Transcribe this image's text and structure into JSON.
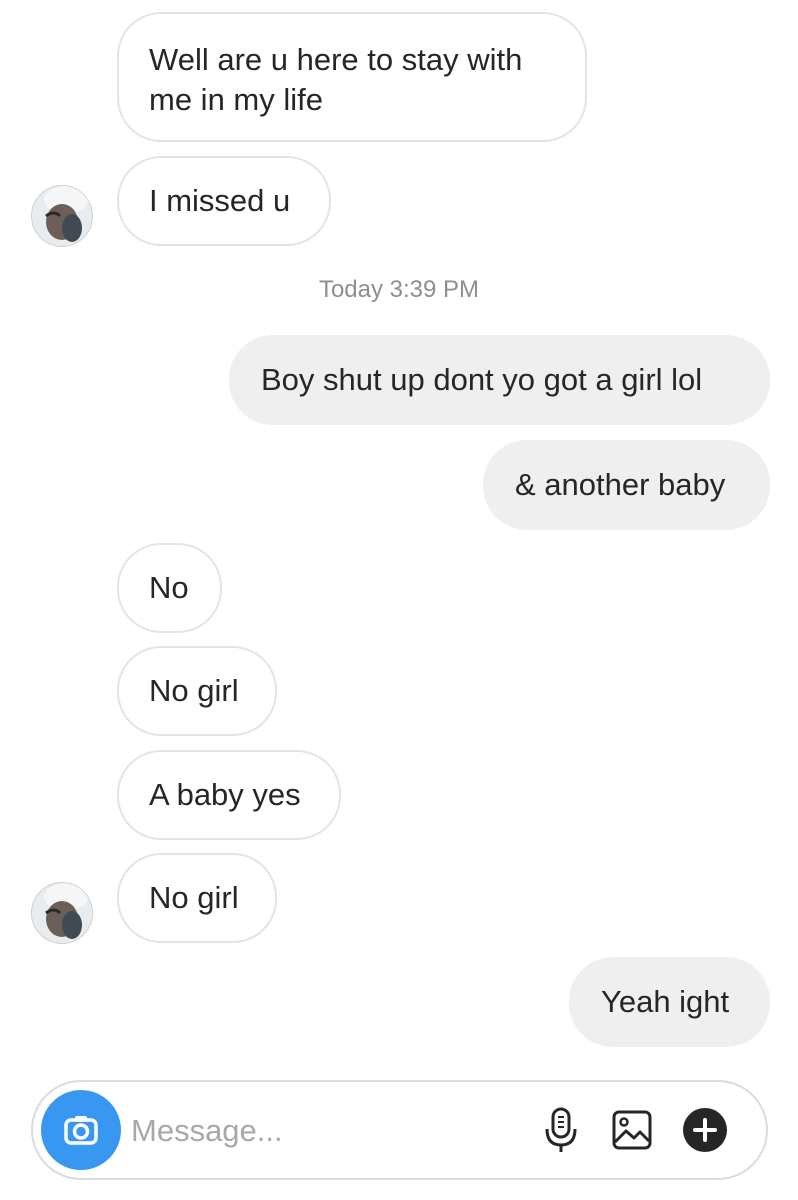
{
  "thread": {
    "messages": [
      {
        "sender": "them",
        "text": "Well are u here to stay with\nme in my life"
      },
      {
        "sender": "them",
        "text": "I missed u"
      },
      {
        "sender": "me",
        "text": "Boy shut up dont yo got a girl lol"
      },
      {
        "sender": "me",
        "text": "& another baby"
      },
      {
        "sender": "them",
        "text": "No"
      },
      {
        "sender": "them",
        "text": "No girl"
      },
      {
        "sender": "them",
        "text": "A baby yes"
      },
      {
        "sender": "them",
        "text": "No girl"
      },
      {
        "sender": "me",
        "text": "Yeah ight"
      }
    ],
    "timestamp": "Today 3:39 PM"
  },
  "composer": {
    "placeholder": "Message...",
    "icons": [
      "camera-icon",
      "microphone-icon",
      "gallery-icon",
      "plus-icon"
    ],
    "accent": "#3897f0"
  },
  "colors": {
    "incoming_bubble_border": "#e4e4e4",
    "outgoing_bubble_bg": "#efefef",
    "timestamp_text": "#8e8e8e"
  }
}
